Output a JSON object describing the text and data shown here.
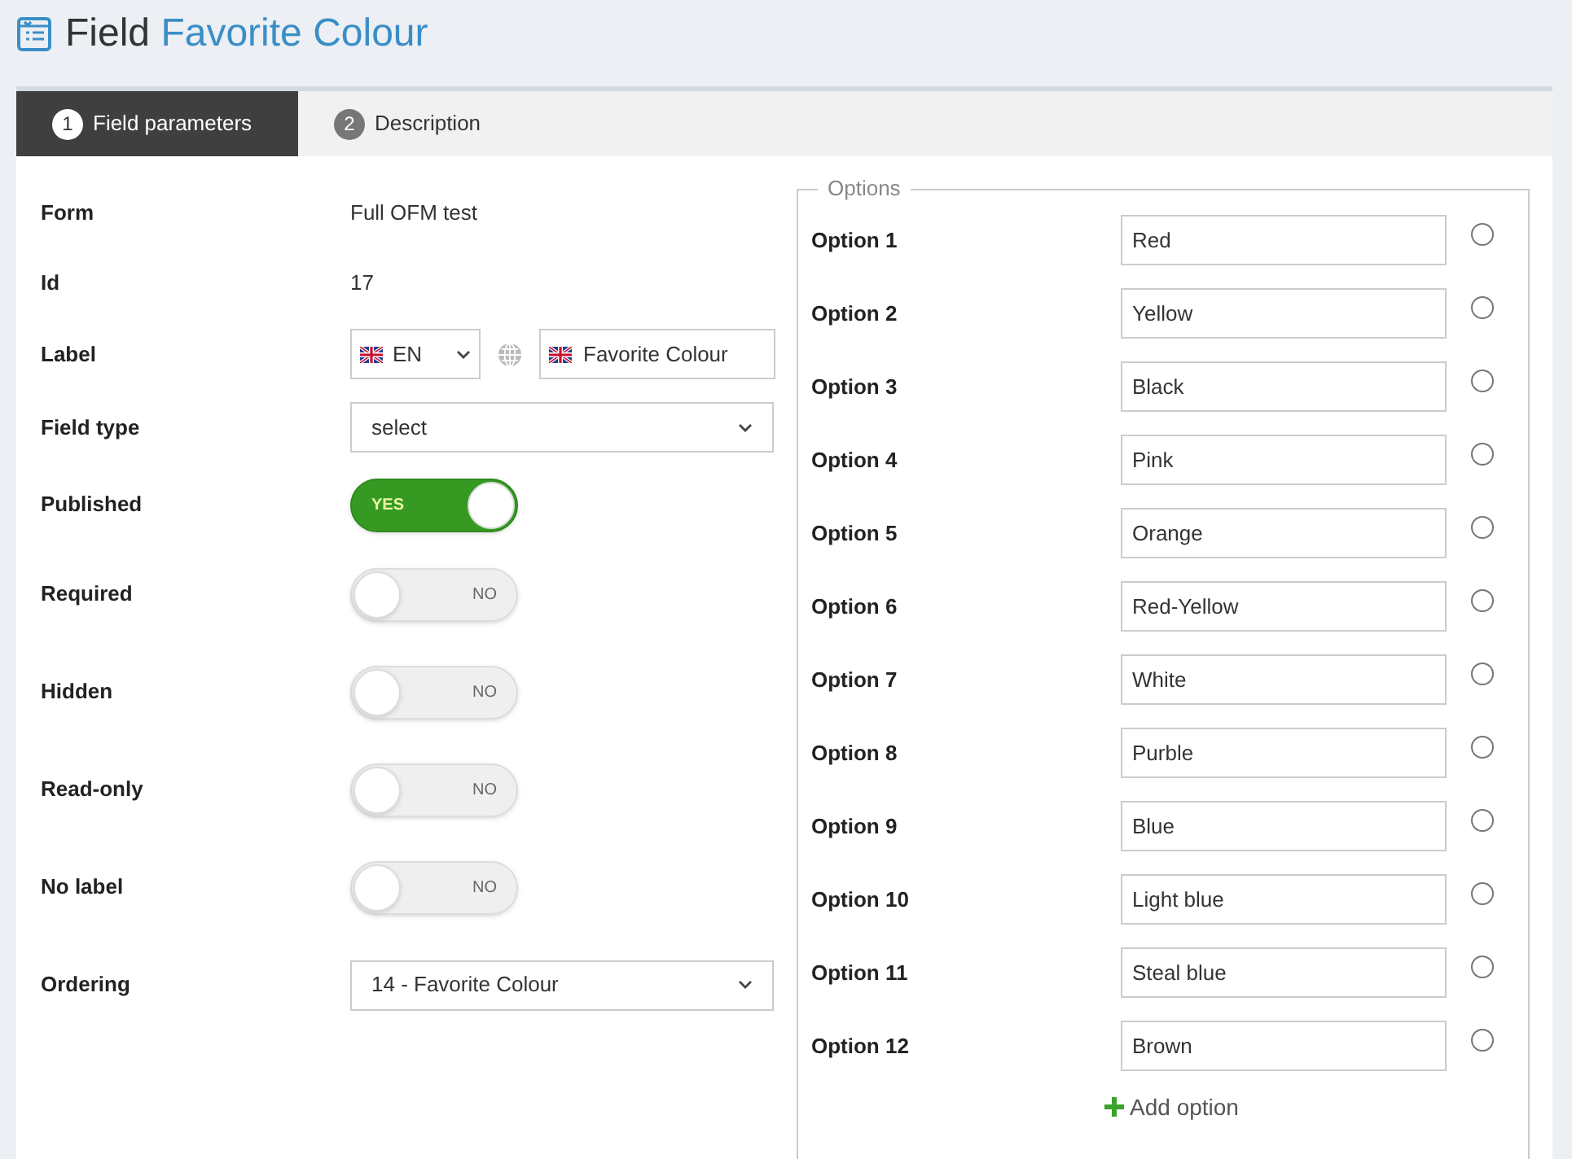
{
  "title": {
    "prefix": "Field",
    "name": "Favorite Colour"
  },
  "tabs": [
    {
      "number": "1",
      "label": "Field parameters",
      "selected": true
    },
    {
      "number": "2",
      "label": "Description",
      "selected": false
    }
  ],
  "fields": [
    {
      "kind": "text",
      "label": "Form",
      "value": "Full OFM test"
    },
    {
      "kind": "text",
      "label": "Id",
      "value": "17"
    },
    {
      "kind": "language",
      "label": "Label",
      "language": "EN",
      "value": "Favorite Colour"
    },
    {
      "kind": "select",
      "label": "Field type",
      "value": "select"
    },
    {
      "kind": "toggle",
      "label": "Published",
      "on": true,
      "text": "YES"
    },
    {
      "kind": "toggle",
      "label": "Required",
      "on": false,
      "text": "NO"
    },
    {
      "kind": "toggle",
      "label": "Hidden",
      "on": false,
      "text": "NO"
    },
    {
      "kind": "toggle",
      "label": "Read-only",
      "on": false,
      "text": "NO"
    },
    {
      "kind": "toggle",
      "label": "No label",
      "on": false,
      "text": "NO"
    },
    {
      "kind": "select",
      "label": "Ordering",
      "value": "14 - Favorite Colour"
    }
  ],
  "options": {
    "legend": "Options",
    "add_label": "Add option",
    "items": [
      {
        "label": "Option 1",
        "value": "Red",
        "selected": false
      },
      {
        "label": "Option 2",
        "value": "Yellow",
        "selected": false
      },
      {
        "label": "Option 3",
        "value": "Black",
        "selected": false
      },
      {
        "label": "Option 4",
        "value": "Pink",
        "selected": false
      },
      {
        "label": "Option 5",
        "value": "Orange",
        "selected": false
      },
      {
        "label": "Option 6",
        "value": "Red-Yellow",
        "selected": false
      },
      {
        "label": "Option 7",
        "value": "White",
        "selected": false
      },
      {
        "label": "Option 8",
        "value": "Purble",
        "selected": false
      },
      {
        "label": "Option 9",
        "value": "Blue",
        "selected": false
      },
      {
        "label": "Option 10",
        "value": "Light blue",
        "selected": false
      },
      {
        "label": "Option 11",
        "value": "Steal blue",
        "selected": false
      },
      {
        "label": "Option 12",
        "value": "Brown",
        "selected": false
      }
    ]
  }
}
